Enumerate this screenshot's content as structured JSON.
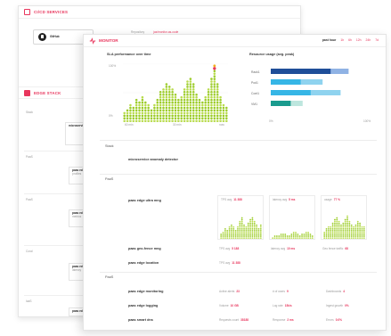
{
  "back": {
    "cicd_title": "CI/CD SERVICES",
    "github_label": "GitHub",
    "repo_label": "Repository",
    "repo_value": "jaz/monitor-as-code",
    "edge_title": "EDGE STACK",
    "sections": [
      "Stack",
      "PaaS",
      "PaaS",
      "Coral",
      "IaaS"
    ],
    "box1_title": "microservice",
    "box2_title": "paas edge",
    "box2_sub": "profiles",
    "box3_title": "paas edge",
    "box3_sub": "metrics",
    "box4_title": "paas edge",
    "box4_sub": "latency",
    "box5_title": "paas edge",
    "box5_sub": "loki"
  },
  "monitor": {
    "title": "MONITOR",
    "range_label": "past hour",
    "ranges": [
      "1h",
      "6h",
      "12h",
      "24h",
      "7d"
    ],
    "sla_title": "SLA performance over time",
    "sla_y_top": "100%",
    "sla_y_mid": "0%",
    "sla_x": [
      "60 min",
      "30 min",
      "now"
    ],
    "resource_title": "Resource usage (avg. peak)",
    "resource_x": [
      "0%",
      "100%"
    ],
    "sections": {
      "stack": "Stack",
      "paas1": "PaaS",
      "paas2": "PaaS"
    },
    "anomaly": "microservice anomaly detector",
    "svc_edge_ml": "paas edge ultra mng",
    "svc_geo": "paas geo-fence mng",
    "svc_location": "paas edge location",
    "svc_monitoring": "paas edge monitoring",
    "svc_logging": "paas edge logging",
    "svc_smart": "paas smart dns",
    "metrics": {
      "m1_label": "TPS avg",
      "m1_value": "11 388",
      "m2_label": "latency avg",
      "m2_value": "5 ms",
      "m3_label": "usage",
      "m3_value": "77 %",
      "geo_tps_label": "TPS avg",
      "geo_tps_value": "5 188",
      "geo_lat_label": "latency avg",
      "geo_lat_value": "10 ms",
      "geo_sat_label": "Geo fence traffic",
      "geo_sat_value": "68",
      "loc_label": "TPS avg",
      "loc_value": "11 388",
      "mon_a_label": "Active alerts",
      "mon_a_value": "23",
      "mon_b_label": "# of users",
      "mon_b_value": "9",
      "mon_c_label": "Dashboards",
      "mon_c_value": "4",
      "log_a_label": "Volume",
      "log_a_value": "10 GB",
      "log_b_label": "Log rate",
      "log_b_value": "15k/s",
      "log_c_label": "Ingest growth",
      "log_c_value": "0%",
      "dns_a_label": "Requests count",
      "dns_a_value": "38188",
      "dns_b_label": "Response",
      "dns_b_value": "2 ms",
      "dns_c_label": "Errors",
      "dns_c_value": "0.0%"
    }
  },
  "chart_data": [
    {
      "type": "bar",
      "title": "SLA performance over time",
      "xlabel": "",
      "ylabel": "",
      "ylim": [
        0,
        100
      ],
      "x_ticks": [
        "60 min",
        "30 min",
        "now"
      ],
      "values": [
        20,
        25,
        30,
        28,
        40,
        35,
        45,
        38,
        30,
        25,
        34,
        42,
        55,
        62,
        70,
        66,
        58,
        50,
        42,
        48,
        60,
        75,
        80,
        70,
        52,
        40,
        36,
        45,
        60,
        78,
        92,
        70,
        45,
        30,
        26
      ]
    },
    {
      "type": "bar",
      "title": "Resource usage (avg. peak)",
      "categories": [
        "Rack1",
        "Pod1",
        "Cont1",
        "VM1"
      ],
      "series": [
        {
          "values": [
            60,
            30,
            40,
            20
          ]
        },
        {
          "values": [
            78,
            52,
            70,
            32
          ]
        }
      ],
      "xlim": [
        0,
        100
      ],
      "x_ticks": [
        "0%",
        "100%"
      ]
    },
    {
      "type": "bar",
      "values": [
        20,
        30,
        45,
        38,
        55,
        62,
        50,
        40,
        55,
        70,
        85,
        60,
        48,
        66,
        78,
        90,
        72,
        58,
        45,
        60
      ]
    },
    {
      "type": "bar",
      "values": [
        10,
        14,
        18,
        16,
        20,
        24,
        22,
        18,
        16,
        20,
        28,
        26,
        22,
        18,
        20,
        24,
        30,
        26,
        22,
        18
      ]
    },
    {
      "type": "bar",
      "values": [
        30,
        42,
        55,
        48,
        66,
        78,
        90,
        70,
        58,
        64,
        82,
        95,
        76,
        60,
        50,
        62,
        74,
        68,
        55,
        48
      ]
    }
  ],
  "colors": {
    "accent": "#e8365d",
    "chart_green": "#9ccc2a",
    "bar_dark": "#1f4e99",
    "bar_light": "#8fb2e4",
    "bar_cyan": "#36b6e6",
    "bar_teal": "#1a9b8e"
  }
}
